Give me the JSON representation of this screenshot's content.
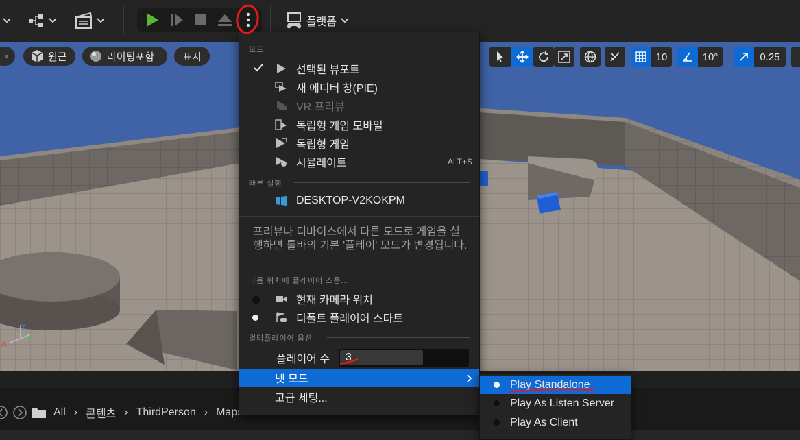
{
  "toolbar": {
    "platform_label": "플랫폼"
  },
  "viewport_toolbar": {
    "perspective_label": "원근",
    "lighting_label": "라이팅포함",
    "show_label": "표시",
    "grid_snap_value": "10",
    "rotation_snap_value": "10°",
    "scale_snap_value": "0.25"
  },
  "menu": {
    "mode_header": "모드",
    "items": [
      {
        "label": "선택된 뷰포트",
        "checked": true,
        "icon": "play-triangle-icon"
      },
      {
        "label": "새 에디터 창(PIE)",
        "icon": "new-window-play-icon"
      },
      {
        "label": "VR 프리뷰",
        "disabled": true,
        "icon": "vr-preview-icon"
      },
      {
        "label": "독립형 게임 모바일",
        "icon": "mobile-game-icon"
      },
      {
        "label": "독립형 게임",
        "icon": "standalone-game-icon"
      },
      {
        "label": "시뮬레이트",
        "shortcut": "ALT+S",
        "icon": "simulate-icon"
      }
    ],
    "quick_launch_header": "빠른 실행",
    "device_label": "DESKTOP-V2KOKPM",
    "description": "프리뷰나 디바이스에서 다른 모드로 게임을 실행하면 툴바의 기본 '플레이' 모드가 변경됩니다.",
    "spawn_header": "다음 위치에 플레이어 스폰...",
    "spawn_items": [
      {
        "label": "현재 카메라 위치",
        "selected": false
      },
      {
        "label": "디폴트 플레이어 스타트",
        "selected": true
      }
    ],
    "multiplayer_header": "멀티플레이어 옵션",
    "player_count_label": "플레이어 수",
    "player_count_value": "3",
    "player_count_fill": 0.65,
    "net_mode_label": "넷 모드",
    "advanced_label": "고급 세팅..."
  },
  "net_mode_submenu": [
    {
      "label": "Play Standalone",
      "selected": true
    },
    {
      "label": "Play As Listen Server",
      "selected": false
    },
    {
      "label": "Play As Client",
      "selected": false
    }
  ],
  "breadcrumb": [
    "All",
    "콘텐츠",
    "ThirdPerson",
    "Maps"
  ],
  "colors": {
    "accent": "#0e6bd6",
    "annotation": "#e11b1b",
    "play_green": "#5cb536"
  }
}
